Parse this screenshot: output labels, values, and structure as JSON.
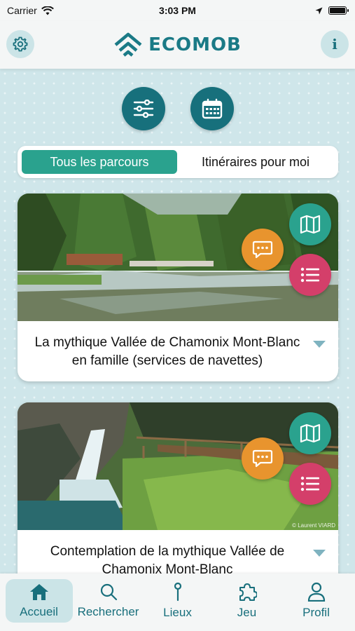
{
  "status_bar": {
    "carrier": "Carrier",
    "time": "3:03 PM",
    "battery_level": 1.0
  },
  "header": {
    "logo_text": "ECOMOB",
    "settings_icon": "gear-icon",
    "info_icon": "info-icon",
    "info_glyph": "i"
  },
  "actions": {
    "filter_icon": "sliders-icon",
    "calendar_icon": "calendar-icon"
  },
  "segmented": {
    "tabs": [
      {
        "label": "Tous les parcours",
        "active": true
      },
      {
        "label": "Itinéraires pour moi",
        "active": false
      }
    ]
  },
  "cards": [
    {
      "title": "La mythique Vallée de Chamonix Mont-Blanc en famille (services de navettes)",
      "credit": ""
    },
    {
      "title": "Contemplation de la mythique Vallée de Chamonix Mont-Blanc",
      "credit": "© Laurent VIARD"
    }
  ],
  "colors": {
    "primary": "#17707c",
    "green": "#2aa28e",
    "orange": "#e8942e",
    "pink": "#d43f6a"
  },
  "tab_bar": {
    "items": [
      {
        "label": "Accueil",
        "icon": "home-icon",
        "active": true
      },
      {
        "label": "Rechercher",
        "icon": "search-icon",
        "active": false
      },
      {
        "label": "Lieux",
        "icon": "pin-icon",
        "active": false
      },
      {
        "label": "Jeu",
        "icon": "puzzle-icon",
        "active": false
      },
      {
        "label": "Profil",
        "icon": "user-icon",
        "active": false
      }
    ]
  }
}
